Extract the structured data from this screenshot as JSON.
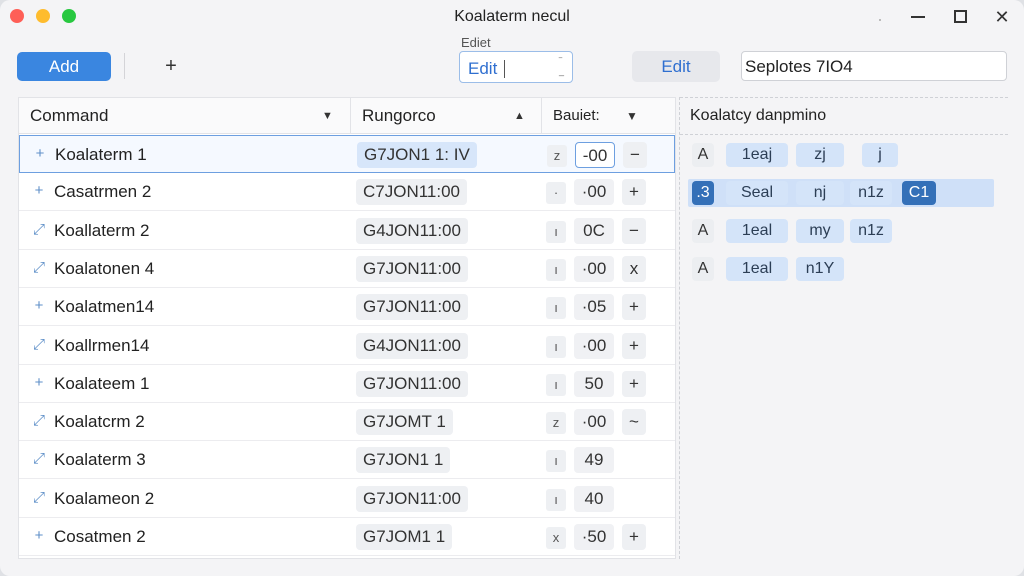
{
  "window": {
    "title": "Koalaterm necul"
  },
  "toolbar": {
    "add_label": "Add",
    "plus_label": "+",
    "edit_field_label": "Ediet",
    "edit_field_value": "Edit",
    "edit_button_label": "Edit",
    "search_value": "Seplotes 7IO4"
  },
  "table": {
    "headers": {
      "command": "Command",
      "range": "Rungorco",
      "status": "Bauiet:"
    },
    "rows": [
      {
        "icon": "+",
        "name": "Koalaterm 1",
        "range": "G7JON1 1: IV",
        "chip": "z",
        "value": "-00",
        "action": "−"
      },
      {
        "icon": "+",
        "name": "Casatrmen 2",
        "range": "C7JON11:00",
        "chip": "·",
        "value": "·00",
        "action": "+"
      },
      {
        "icon": "⤢",
        "name": "Koallaterm 2",
        "range": "G4JON11:00",
        "chip": "ı",
        "value": "0C",
        "action": "−"
      },
      {
        "icon": "⤢",
        "name": "Koalatonen 4",
        "range": "G7JON11:00",
        "chip": "ı",
        "value": "·00",
        "action": "x"
      },
      {
        "icon": "+",
        "name": "Koalatmen14",
        "range": "G7JON11:00",
        "chip": "ı",
        "value": "·05",
        "action": "+"
      },
      {
        "icon": "⤢",
        "name": "Koallrmen14",
        "range": "G4JON11:00",
        "chip": "ı",
        "value": "·00",
        "action": "+"
      },
      {
        "icon": "+",
        "name": "Koalateem 1",
        "range": "G7JON11:00",
        "chip": "ı",
        "value": "50",
        "action": "+"
      },
      {
        "icon": "⤢",
        "name": "Koalatcrm 2",
        "range": "G7JOMT 1",
        "chip": "z",
        "value": "·00",
        "action": "~"
      },
      {
        "icon": "⤢",
        "name": "Koalaterm 3",
        "range": "G7JON1 1",
        "chip": "ı",
        "value": "49",
        "action": ""
      },
      {
        "icon": "⤢",
        "name": "Koalameon 2",
        "range": "G7JON11:00",
        "chip": "ı",
        "value": "40",
        "action": ""
      },
      {
        "icon": "+",
        "name": "Cosatmen 2",
        "range": "G7JOM1 1",
        "chip": "x",
        "value": "·50",
        "action": "+"
      }
    ]
  },
  "panel": {
    "title": "Koalatcy danpmino",
    "rows": [
      [
        "A",
        "1eaj",
        "zj",
        "j"
      ],
      [
        ".3",
        "Seal",
        "nj",
        "n1z",
        "C1"
      ],
      [
        "A",
        "1eal",
        "my",
        "n1z"
      ],
      [
        "A",
        "1eal",
        "n1Y"
      ]
    ]
  }
}
